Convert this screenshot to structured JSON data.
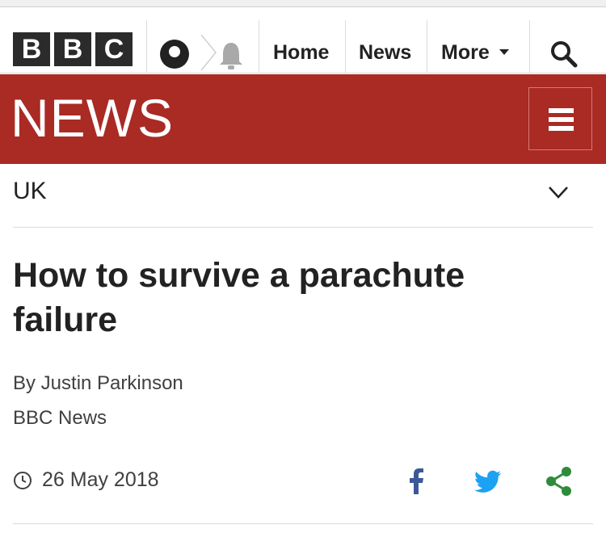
{
  "masthead": {
    "logo_letters": [
      "B",
      "B",
      "C"
    ],
    "nav": {
      "home": "Home",
      "news": "News",
      "more": "More"
    },
    "icons": [
      "account-icon",
      "notifications-bell-icon",
      "search-icon"
    ]
  },
  "banner": {
    "title": "NEWS",
    "background_color": "#aa2a24"
  },
  "section": {
    "label": "UK"
  },
  "article": {
    "headline": "How to survive a parachute failure",
    "byline": "By Justin Parkinson",
    "source": "BBC News",
    "date": "26 May 2018"
  },
  "share": {
    "icons": [
      "facebook-icon",
      "twitter-icon",
      "share-icon"
    ],
    "colors": {
      "facebook": "#3b5998",
      "twitter": "#1da1f2",
      "share": "#2e8b3a"
    }
  }
}
